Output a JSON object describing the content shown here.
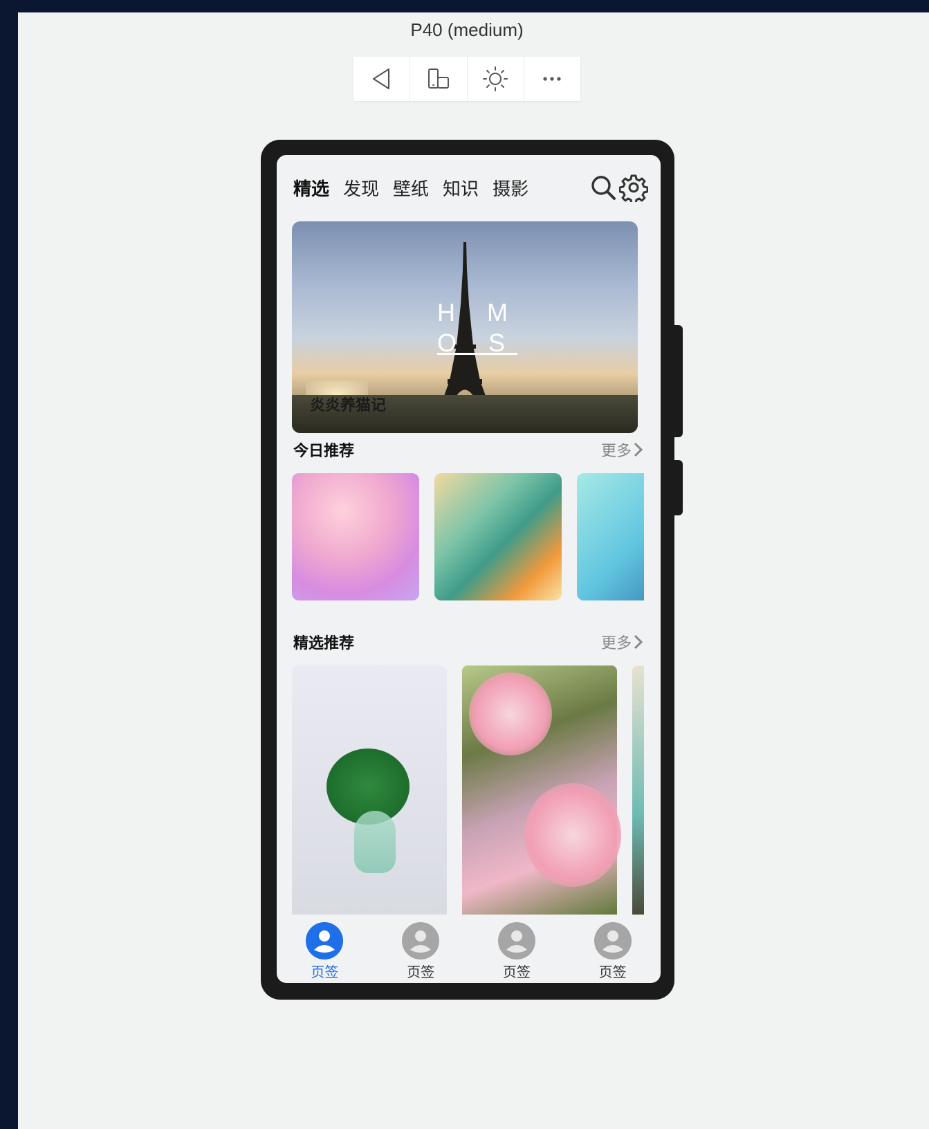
{
  "device": {
    "title": "P40 (medium)"
  },
  "toolbar": {
    "buttons": [
      "back-icon",
      "rotate-device-icon",
      "brightness-icon",
      "more-icon"
    ]
  },
  "app": {
    "tabs": [
      {
        "label": "精选",
        "active": true
      },
      {
        "label": "发现",
        "active": false
      },
      {
        "label": "壁纸",
        "active": false
      },
      {
        "label": "知识",
        "active": false
      },
      {
        "label": "摄影",
        "active": false
      }
    ],
    "banner": {
      "logo_line1": "H M",
      "logo_line2": "O S",
      "caption": "炎炎养猫记"
    },
    "today": {
      "title": "今日推荐",
      "more": "更多"
    },
    "featured": {
      "title": "精选推荐",
      "more": "更多"
    },
    "bottom_tabs": [
      {
        "label": "页签",
        "active": true
      },
      {
        "label": "页签",
        "active": false
      },
      {
        "label": "页签",
        "active": false
      },
      {
        "label": "页签",
        "active": false
      }
    ]
  },
  "colors": {
    "accent": "#1e6fe8",
    "inactive": "#a6a6a6"
  }
}
